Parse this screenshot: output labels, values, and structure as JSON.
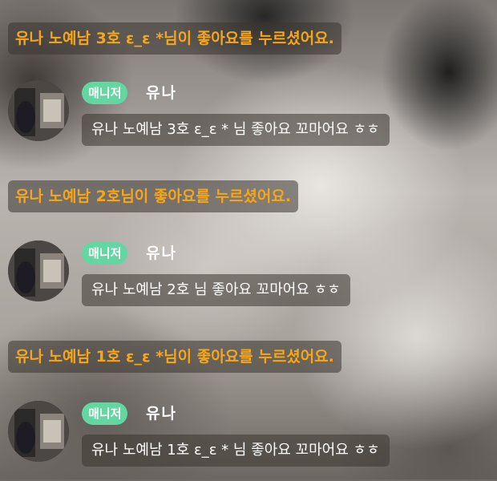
{
  "notices": [
    {
      "text": "유나 노예남 3호 ε_ε *님이 좋아요를 누르셨어요."
    },
    {
      "text": "유나 노예남 2호님이 좋아요를 누르셨어요."
    },
    {
      "text": "유나 노예남 1호 ε_ε *님이 좋아요를 누르셨어요."
    }
  ],
  "messages": [
    {
      "badge": "매니저",
      "nickname": "유나",
      "text": "유나 노예남 3호 ε_ε * 님 좋아요 꼬마어요 ㅎㅎ"
    },
    {
      "badge": "매니저",
      "nickname": "유나",
      "text": "유나 노예남 2호 님 좋아요 꼬마어요 ㅎㅎ"
    },
    {
      "badge": "매니저",
      "nickname": "유나",
      "text": "유나 노예남 1호 ε_ε * 님 좋아요 꼬마어요 ㅎㅎ"
    }
  ],
  "colors": {
    "notice_text": "#f5a61a",
    "badge_bg": "#63d6a2",
    "message_text": "#ffffff"
  }
}
